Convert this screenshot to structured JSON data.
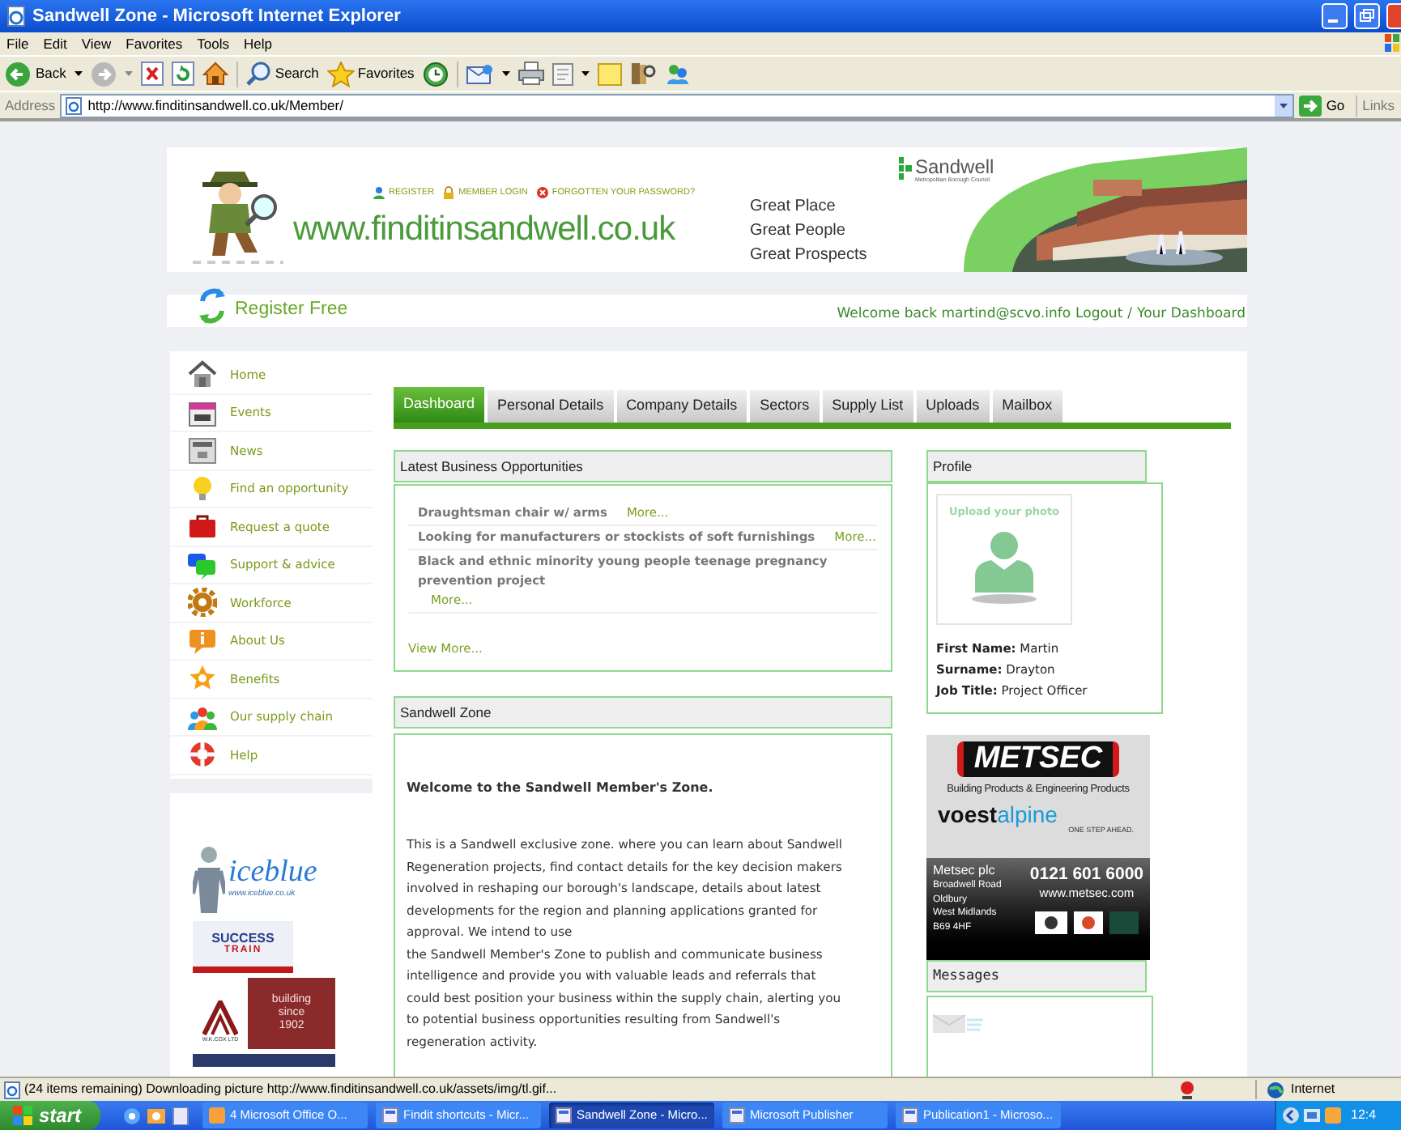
{
  "window": {
    "title": "Sandwell Zone - Microsoft Internet Explorer"
  },
  "menu": [
    "File",
    "Edit",
    "View",
    "Favorites",
    "Tools",
    "Help"
  ],
  "toolbar": {
    "back": "Back",
    "search": "Search",
    "favorites": "Favorites"
  },
  "address_bar": {
    "label": "Address",
    "url": "http://www.finditinsandwell.co.uk/Member/",
    "go": "Go",
    "links": "Links"
  },
  "header": {
    "links": [
      "REGISTER",
      "MEMBER LOGIN",
      "FORGOTTEN YOUR PASSWORD?"
    ],
    "site": "www.finditinsandwell.co.uk",
    "taglines": [
      "Great Place",
      "Great People",
      "Great Prospects"
    ],
    "council": "Sandwell",
    "council_subtitle": "Metropolitan Borough Council"
  },
  "register_bar": {
    "register": "Register Free",
    "welcome": "Welcome back martind@scvo.info",
    "logout": "Logout",
    "separator": "/",
    "dashboard": "Your Dashboard"
  },
  "sidebar": {
    "items": [
      "Home",
      "Events",
      "News",
      "Find an opportunity",
      "Request a quote",
      "Support & advice",
      "Workforce",
      "About Us",
      "Benefits",
      "Our supply chain",
      "Help"
    ]
  },
  "sidebar_ads": {
    "iceblue": "iceblue",
    "iceblue_url": "www.iceblue.co.uk",
    "success": "SUCCESS",
    "train": "TRAIN",
    "building": "building",
    "since": "since",
    "year": "1902",
    "company": "W.K.COX LTD"
  },
  "tabs": [
    {
      "label": "Dashboard",
      "selected": true
    },
    {
      "label": "Personal Details",
      "selected": false
    },
    {
      "label": "Company Details",
      "selected": false
    },
    {
      "label": "Sectors",
      "selected": false
    },
    {
      "label": "Supply List",
      "selected": false
    },
    {
      "label": "Uploads",
      "selected": false
    },
    {
      "label": "Mailbox",
      "selected": false
    }
  ],
  "opportunities": {
    "title": "Latest Business Opportunities",
    "items": [
      {
        "title": "Draughtsman chair w/ arms",
        "link": "More..."
      },
      {
        "title": "Looking for manufacturers or stockists of soft furnishings",
        "link": "More..."
      },
      {
        "title": "Black and ethnic minority young people teenage pregnancy prevention project",
        "link": "More..."
      }
    ],
    "view_more": "View More..."
  },
  "zone": {
    "title": "Sandwell Zone",
    "heading": "Welcome to the Sandwell Member's Zone.",
    "paragraphs": [
      "This is a Sandwell exclusive zone. where you can learn about Sandwell Regeneration projects, find contact details for the key decision makers involved in reshaping our borough's landscape, details about latest developments for the region and planning applications granted for approval. We intend to use",
      "the Sandwell Member's Zone to publish and communicate business intelligence and provide you with valuable leads and referrals that could best position your business within the supply chain, alerting you to potential business opportunities resulting from Sandwell's regeneration activity."
    ]
  },
  "profile": {
    "title": "Profile",
    "photo_label": "Upload your photo",
    "fields": [
      {
        "label": "First Name:",
        "value": "Martin"
      },
      {
        "label": "Surname:",
        "value": "Drayton"
      },
      {
        "label": "Job Title:",
        "value": "Project Officer"
      }
    ]
  },
  "ad": {
    "brand": "METSEC",
    "tagline": "Building Products & Engineering Products",
    "partner_a": "voest",
    "partner_b": "alpine",
    "slogan": "ONE STEP AHEAD.",
    "address": [
      "Metsec plc",
      "Broadwell Road",
      "Oldbury",
      "West Midlands",
      "B69 4HF"
    ],
    "phone": "0121 601 6000",
    "web": "www.metsec.com"
  },
  "messages": {
    "title": "Messages"
  },
  "status_bar": {
    "text": "(24 items remaining) Downloading picture http://www.finditinsandwell.co.uk/assets/img/tl.gif...",
    "zone": "Internet"
  },
  "taskbar": {
    "start": "start",
    "tasks": [
      {
        "label": "4 Microsoft Office O...",
        "selected": false
      },
      {
        "label": "Findit shortcuts - Micr...",
        "selected": false
      },
      {
        "label": "Sandwell Zone - Micro...",
        "selected": true
      },
      {
        "label": "Microsoft Publisher",
        "selected": false
      },
      {
        "label": "Publication1 - Microso...",
        "selected": false
      }
    ],
    "clock": "12:4"
  }
}
